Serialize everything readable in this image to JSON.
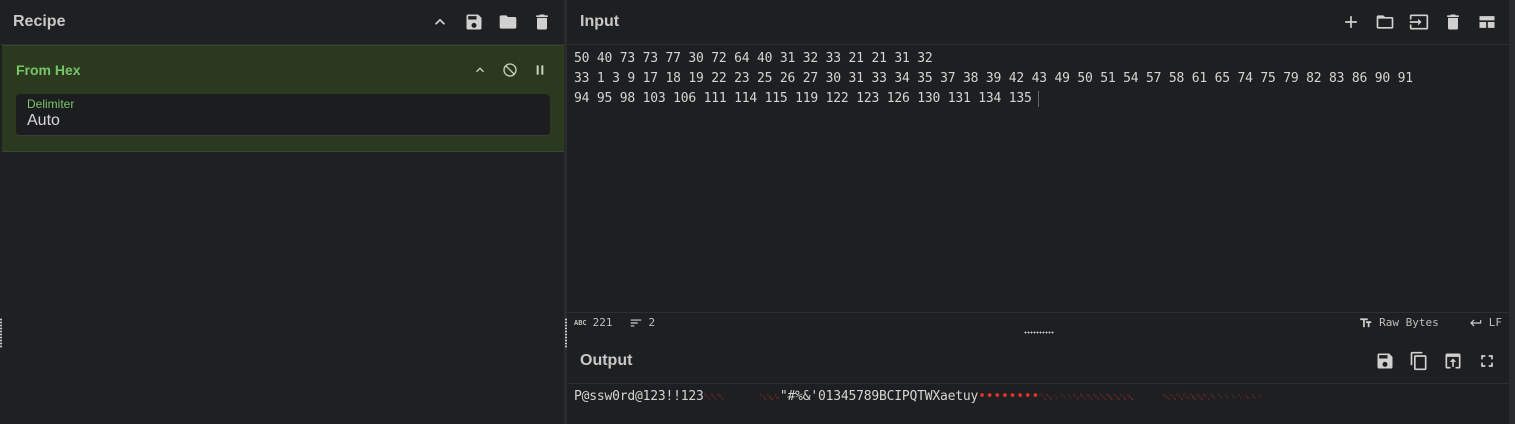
{
  "recipe": {
    "title": "Recipe",
    "icons": [
      "chevron-up-icon",
      "save-icon",
      "folder-icon",
      "trash-icon"
    ],
    "operation": {
      "name": "From Hex",
      "delimiter_label": "Delimiter",
      "delimiter_value": "Auto"
    }
  },
  "input": {
    "title": "Input",
    "lines": [
      "50 40 73 73 77 30 72 64 40 31 32 33 21 21 31 32",
      "33 1 3 9 17 18 19 22 23 25 26 27 30 31 33 34 35 37 38 39 42 43 49 50 51 54 57 58 61 65 74 75 79 82 83 86 90 91",
      "94 95 98 103 106 111 114 115 119 122 123 126 130 131 134 135"
    ],
    "status": {
      "length": "221",
      "lines": "2",
      "encoding": "Raw Bytes",
      "eol": "LF"
    }
  },
  "output": {
    "title": "Output",
    "text_start": "P@ssw0rd@123!!123",
    "ctrl_a": "␑␒␓",
    "ctrl_b": "␗␘␙",
    "text_mid": "\"#%&'01345789BCIPQTWXaetuy",
    "dots": "••••••••",
    "ctrl_c": "␃␆␊␋␏␐␑␒␓␔␕␖␗␘",
    "ctrl_d": "␁␂␃␄␅␆␇␈␉␊␋␌␍␎␏"
  }
}
